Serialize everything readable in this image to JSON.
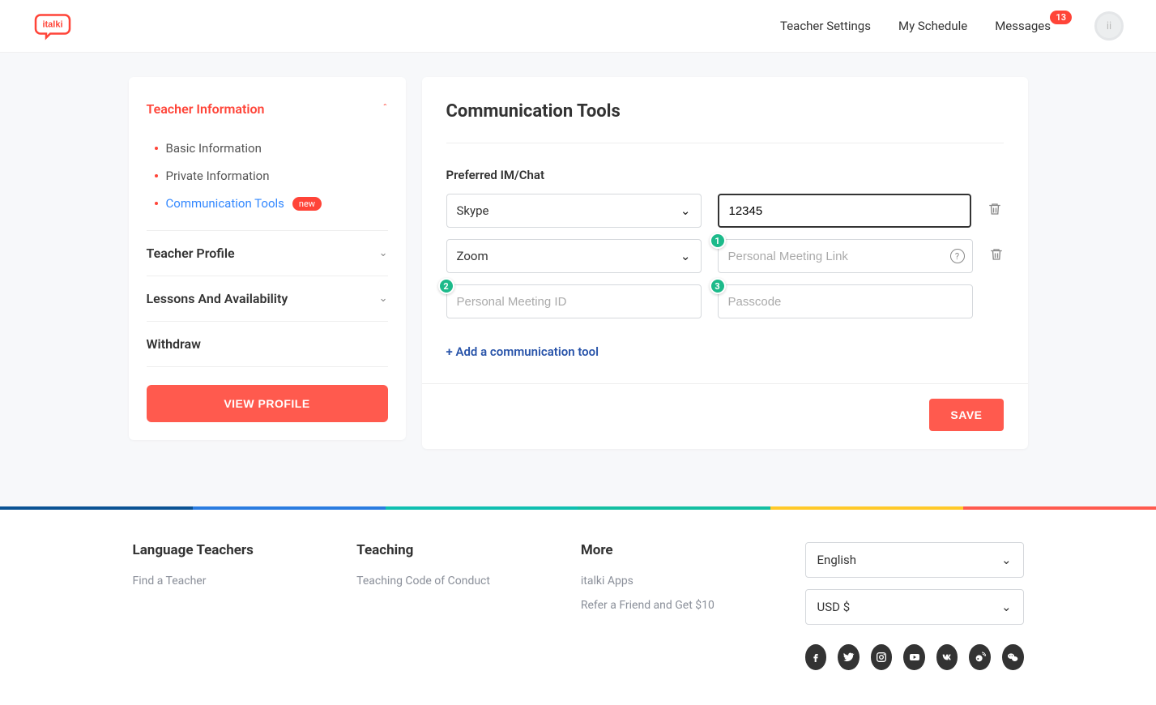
{
  "header": {
    "nav": [
      "Teacher Settings",
      "My Schedule",
      "Messages"
    ],
    "messages_badge": "13"
  },
  "sidebar": {
    "sections": [
      {
        "title": "Teacher Information",
        "expanded": true,
        "active": true,
        "items": [
          {
            "label": "Basic Information",
            "active": false
          },
          {
            "label": "Private Information",
            "active": false
          },
          {
            "label": "Communication Tools",
            "active": true,
            "new_badge": "new"
          }
        ]
      },
      {
        "title": "Teacher Profile",
        "expanded": false
      },
      {
        "title": "Lessons And Availability",
        "expanded": false
      },
      {
        "title": "Withdraw",
        "expanded": false,
        "no_chevron": true
      }
    ],
    "view_profile": "VIEW PROFILE"
  },
  "content": {
    "title": "Communication Tools",
    "preferred_label": "Preferred IM/Chat",
    "tools": [
      {
        "type": "Skype",
        "value": "12345"
      },
      {
        "type": "Zoom",
        "link_placeholder": "Personal Meeting Link",
        "id_placeholder": "Personal Meeting ID",
        "pass_placeholder": "Passcode"
      }
    ],
    "badges": {
      "b1": "1",
      "b2": "2",
      "b3": "3"
    },
    "add_tool": "+ Add a communication tool",
    "save": "SAVE"
  },
  "footer": {
    "cols": [
      {
        "title": "Language Teachers",
        "links": [
          "Find a Teacher"
        ]
      },
      {
        "title": "Teaching",
        "links": [
          "Teaching Code of Conduct"
        ]
      },
      {
        "title": "More",
        "links": [
          "italki Apps",
          "Refer a Friend and Get $10"
        ]
      }
    ],
    "language": "English",
    "currency": "USD $"
  }
}
